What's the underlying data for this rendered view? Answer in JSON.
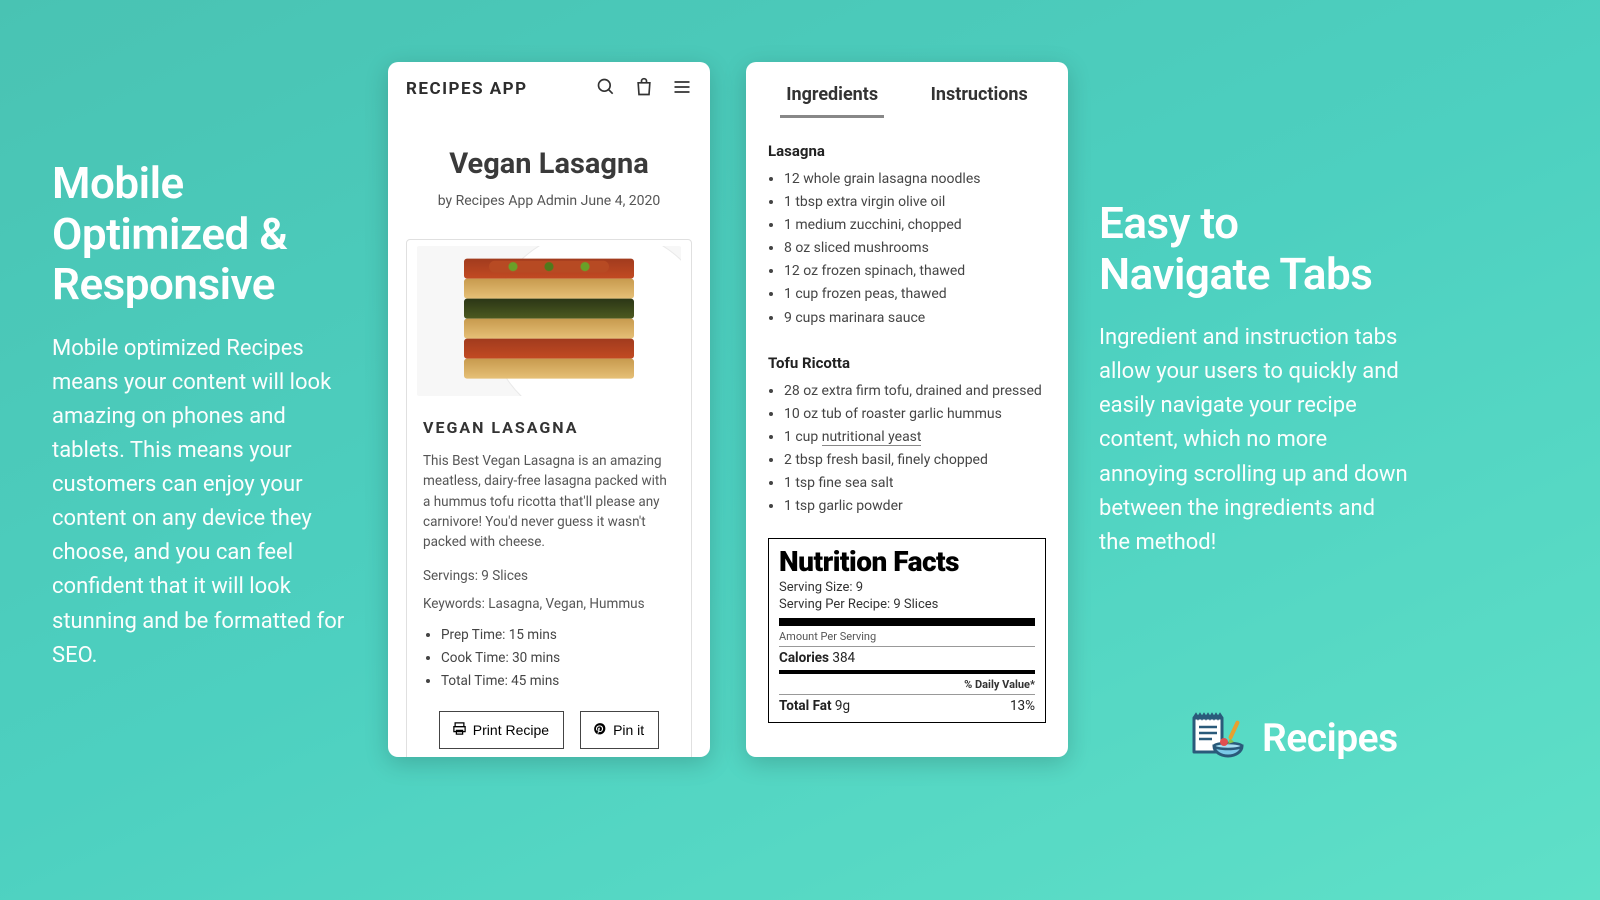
{
  "left_feature": {
    "heading": "Mobile Optimized & Responsive",
    "body": "Mobile optimized Recipes means your content will look amazing on phones and tablets. This means your customers can enjoy your content on any device they choose, and you can feel confident that it will look stunning and be formatted for SEO."
  },
  "right_feature": {
    "heading": "Easy to Navigate Tabs",
    "body": "Ingredient and instruction tabs allow your users to quickly and easily navigate your recipe content, which no more annoying scrolling up and down between the ingredients and the method!"
  },
  "phone_a": {
    "brand": "RECIPES APP",
    "title": "Vegan Lasagna",
    "byline": "by Recipes App Admin   June 4, 2020",
    "card_heading": "VEGAN LASAGNA",
    "description": "This Best Vegan Lasagna is an amazing meatless, dairy-free lasagna packed with a hummus tofu ricotta that'll please any carnivore! You'd never guess it wasn't packed with cheese.",
    "servings": "Servings: 9 Slices",
    "keywords": "Keywords: Lasagna, Vegan, Hummus",
    "times": [
      "Prep Time: 15 mins",
      "Cook Time: 30 mins",
      "Total Time: 45 mins"
    ],
    "print_label": "Print Recipe",
    "pin_label": "Pin it"
  },
  "phone_b": {
    "tabs": {
      "ingredients": "Ingredients",
      "instructions": "Instructions"
    },
    "section1": {
      "title": "Lasagna",
      "items": [
        "12 whole grain lasagna noodles",
        "1 tbsp extra virgin olive oil",
        "1 medium zucchini, chopped",
        "8 oz sliced mushrooms",
        "12 oz frozen spinach, thawed",
        "1 cup frozen peas, thawed",
        "9 cups marinara sauce"
      ]
    },
    "section2": {
      "title": "Tofu Ricotta",
      "items_pre": "28 oz extra firm tofu, drained and pressed",
      "items": [
        "10 oz tub of roaster garlic hummus"
      ],
      "linked_pre": "1 cup ",
      "linked_text": "nutritional yeast",
      "items_after": [
        "2 tbsp fresh basil, finely chopped",
        "1 tsp fine sea salt",
        "1 tsp garlic powder"
      ]
    },
    "nutrition": {
      "title": "Nutrition Facts",
      "serving_size": "Serving Size: 9",
      "per_recipe": "Serving Per Recipe: 9 Slices",
      "amount_label": "Amount Per Serving",
      "calories_label": "Calories",
      "calories_value": "384",
      "dv_label": "% Daily Value*",
      "fat_label": "Total Fat",
      "fat_value": "9g",
      "fat_dv": "13%"
    }
  },
  "footer": {
    "word": "Recipes"
  }
}
